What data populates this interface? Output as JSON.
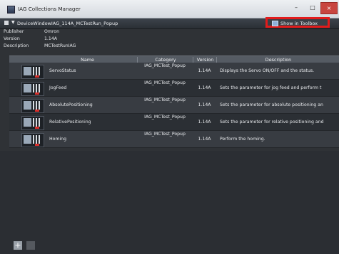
{
  "window": {
    "title": "IAG Collections Manager",
    "controls": [
      "–",
      "□",
      "×"
    ]
  },
  "device": {
    "title": "DeviceWindowIAG_114A_MCTestRun_Popup",
    "toolbox_label": "Show in Toolbox"
  },
  "meta": {
    "publisher_label": "Publisher",
    "publisher_value": "Omron",
    "version_label": "Version",
    "version_value": "1.14A",
    "description_label": "Description",
    "description_value": "MCTestRunIAG"
  },
  "table": {
    "headers": [
      "Name",
      "Category",
      "Version",
      "Description"
    ],
    "rows": [
      {
        "name": "ServoStatus",
        "category": "IAG_MCTest_Popup",
        "version": "1.14A",
        "description": "Displays the Servo ON/OFF and the status."
      },
      {
        "name": "JogFeed",
        "category": "IAG_MCTest_Popup",
        "version": "1.14A",
        "description": "Sets the parameter for jog feed and perform t"
      },
      {
        "name": "AbsolutePositioning",
        "category": "IAG_MCTest_Popup",
        "version": "1.14A",
        "description": "Sets the parameter for absolute positioning an"
      },
      {
        "name": "RelativePositioning",
        "category": "IAG_MCTest_Popup",
        "version": "1.14A",
        "description": "Sets the parameter for relative positioning and"
      },
      {
        "name": "Homing",
        "category": "IAG_MCTest_Popup",
        "version": "1.14A",
        "description": "Perform the homing."
      }
    ]
  },
  "footer": {
    "add_label": "+"
  },
  "colors": {
    "highlight": "#e11b1b",
    "background": "#2f3236"
  }
}
